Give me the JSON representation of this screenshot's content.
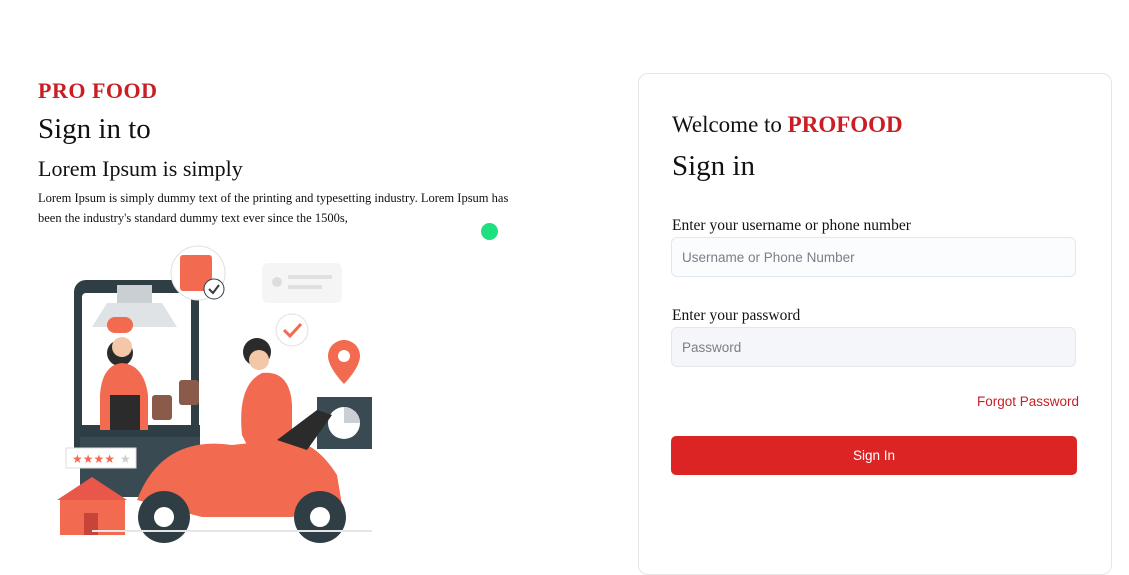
{
  "left": {
    "brand": "PRO FOOD",
    "heading": "Sign in to",
    "subheading": "Lorem Ipsum is simply",
    "description": "Lorem Ipsum is simply dummy text of the printing and typesetting industry. Lorem Ipsum has been the industry's standard dummy text ever since the 1500s,",
    "illustration_icon": "delivery-scooter-illustration"
  },
  "form": {
    "welcome_prefix": "Welcome to ",
    "welcome_brand": "PROFOOD",
    "title": "Sign in",
    "username_label": "Enter your username or phone number",
    "username_placeholder": "Username or Phone Number",
    "password_label": "Enter your password",
    "password_placeholder": "Password",
    "forgot_label": "Forgot Password",
    "submit_label": "Sign In"
  },
  "colors": {
    "brand_red": "#c81e24",
    "button_red": "#dc2424",
    "indicator_green": "#1fe07e"
  }
}
